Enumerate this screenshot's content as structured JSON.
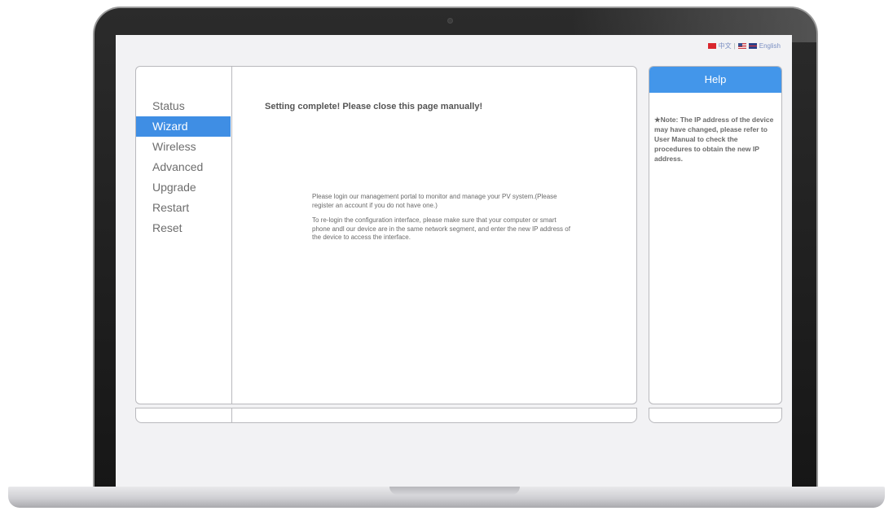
{
  "language_bar": {
    "chinese": "中文",
    "separator": "|",
    "english": "English",
    "icons": [
      "china-flag-icon",
      "usa-flag-icon",
      "uk-flag-icon"
    ]
  },
  "sidebar": {
    "items": [
      {
        "label": "Status",
        "active": false
      },
      {
        "label": "Wizard",
        "active": true
      },
      {
        "label": "Wireless",
        "active": false
      },
      {
        "label": "Advanced",
        "active": false
      },
      {
        "label": "Upgrade",
        "active": false
      },
      {
        "label": "Restart",
        "active": false
      },
      {
        "label": "Reset",
        "active": false
      }
    ]
  },
  "main": {
    "complete_message": "Setting complete! Please close this page manually!",
    "paragraph1": "Please login our management portal to monitor and manage your PV system.(Please register an account if you do not have one.)",
    "paragraph2": "To re-login the configuration interface, please make sure that your computer or smart phone andl our device are in the same network segment, and enter the new IP address of the device to access the interface."
  },
  "help": {
    "title": "Help",
    "note": "★Note: The IP address of the device may have changed, please refer to User Manual to check the procedures to obtain the new IP address."
  },
  "colors": {
    "accent": "#3f8ee4",
    "help_header": "#4396ea",
    "bezel": "#1c1c1c",
    "screen_bg": "#f2f2f4"
  }
}
